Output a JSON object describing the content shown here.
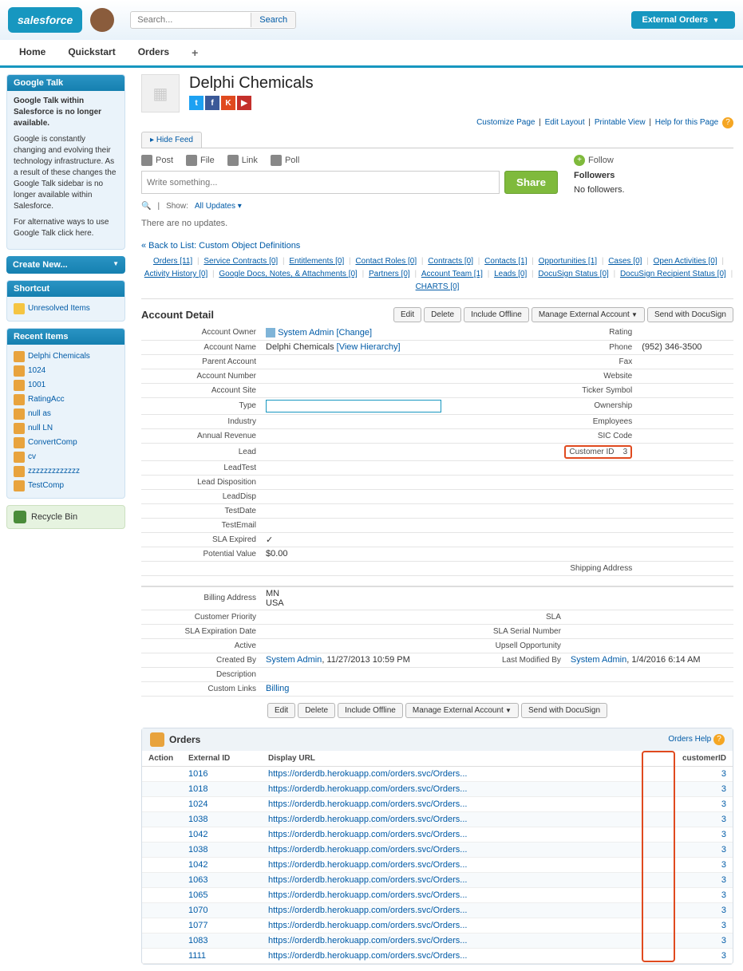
{
  "header": {
    "logo": "salesforce",
    "search_placeholder": "Search...",
    "search_btn": "Search",
    "ext_orders": "External Orders"
  },
  "tabs": [
    "Home",
    "Quickstart",
    "Orders"
  ],
  "sidebar": {
    "gtalk": {
      "title": "Google Talk",
      "line1": "Google Talk within Salesforce is no longer available.",
      "line2": "Google is constantly changing and evolving their technology infrastructure. As a result of these changes the Google Talk sidebar is no longer available within Salesforce.",
      "line3": "For alternative ways to use Google Talk click here."
    },
    "create_new": "Create New...",
    "shortcut": {
      "title": "Shortcut",
      "item": "Unresolved Items"
    },
    "recent": {
      "title": "Recent Items",
      "items": [
        "Delphi Chemicals",
        "1024",
        "1001",
        "RatingAcc",
        "null as",
        "null LN",
        "ConvertComp",
        "cv",
        "zzzzzzzzzzzzz",
        "TestComp"
      ]
    },
    "recycle": "Recycle Bin"
  },
  "page": {
    "title": "Delphi Chemicals",
    "top_links": [
      "Customize Page",
      "Edit Layout",
      "Printable View",
      "Help for this Page"
    ],
    "hide_feed": "Hide Feed",
    "feed_tabs": [
      "Post",
      "File",
      "Link",
      "Poll"
    ],
    "feed_placeholder": "Write something...",
    "share": "Share",
    "show": "Show:",
    "all_updates": "All Updates",
    "no_updates": "There are no updates.",
    "follow": "Follow",
    "followers": "Followers",
    "no_followers": "No followers.",
    "back": "« Back to List: Custom Object Definitions"
  },
  "related_nav": [
    {
      "label": "Orders",
      "count": "[11]"
    },
    {
      "label": "Service Contracts",
      "count": "[0]"
    },
    {
      "label": "Entitlements",
      "count": "[0]"
    },
    {
      "label": "Contact Roles",
      "count": "[0]"
    },
    {
      "label": "Contracts",
      "count": "[0]"
    },
    {
      "label": "Contacts",
      "count": "[1]"
    },
    {
      "label": "Opportunities",
      "count": "[1]"
    },
    {
      "label": "Cases",
      "count": "[0]"
    },
    {
      "label": "Open Activities",
      "count": "[0]"
    },
    {
      "label": "Activity History",
      "count": "[0]"
    },
    {
      "label": "Google Docs, Notes, & Attachments",
      "count": "[0]"
    },
    {
      "label": "Partners",
      "count": "[0]"
    },
    {
      "label": "Account Team",
      "count": "[1]"
    },
    {
      "label": "Leads",
      "count": "[0]"
    },
    {
      "label": "DocuSign Status",
      "count": "[0]"
    },
    {
      "label": "DocuSign Recipient Status",
      "count": "[0]"
    },
    {
      "label": "CHARTS",
      "count": "[0]"
    }
  ],
  "detail": {
    "title": "Account Detail",
    "buttons": [
      "Edit",
      "Delete",
      "Include Offline",
      "Manage External Account",
      "Send with DocuSign"
    ],
    "owner_lbl": "Account Owner",
    "owner_val": "System Admin",
    "owner_change": "[Change]",
    "rating_lbl": "Rating",
    "name_lbl": "Account Name",
    "name_val": "Delphi Chemicals",
    "view_h": "[View Hierarchy]",
    "phone_lbl": "Phone",
    "phone_val": "(952) 346-3500",
    "parent_lbl": "Parent Account",
    "fax_lbl": "Fax",
    "num_lbl": "Account Number",
    "web_lbl": "Website",
    "site_lbl": "Account Site",
    "ticker_lbl": "Ticker Symbol",
    "type_lbl": "Type",
    "own_lbl": "Ownership",
    "industry_lbl": "Industry",
    "emp_lbl": "Employees",
    "rev_lbl": "Annual Revenue",
    "sic_lbl": "SIC Code",
    "lead_lbl": "Lead",
    "custid_lbl": "Customer ID",
    "custid_val": "3",
    "leadtest_lbl": "LeadTest",
    "leaddisp_lbl": "Lead Disposition",
    "leaddisp2_lbl": "LeadDisp",
    "testdate_lbl": "TestDate",
    "testemail_lbl": "TestEmail",
    "sla_lbl": "SLA Expired",
    "sla_val": "✓",
    "pot_lbl": "Potential Value",
    "pot_val": "$0.00",
    "ship_lbl": "Shipping Address",
    "bill_lbl": "Billing Address",
    "bill_val1": "MN",
    "bill_val2": "USA",
    "prio_lbl": "Customer Priority",
    "sla2_lbl": "SLA",
    "slaexp_lbl": "SLA Expiration Date",
    "slaser_lbl": "SLA Serial Number",
    "active_lbl": "Active",
    "upsell_lbl": "Upsell Opportunity",
    "created_lbl": "Created By",
    "created_user": "System Admin",
    "created_date": ", 11/27/2013 10:59 PM",
    "modified_lbl": "Last Modified By",
    "modified_user": "System Admin",
    "modified_date": ", 1/4/2016 6:14 AM",
    "desc_lbl": "Description",
    "custom_lbl": "Custom Links",
    "custom_val": "Billing"
  },
  "orders": {
    "title": "Orders",
    "help": "Orders Help",
    "cols": {
      "action": "Action",
      "ext": "External ID",
      "url": "Display URL",
      "cust": "customerID"
    },
    "rows": [
      {
        "ext": "1016",
        "url": "https://orderdb.herokuapp.com/orders.svc/Orders...",
        "cust": "3"
      },
      {
        "ext": "1018",
        "url": "https://orderdb.herokuapp.com/orders.svc/Orders...",
        "cust": "3"
      },
      {
        "ext": "1024",
        "url": "https://orderdb.herokuapp.com/orders.svc/Orders...",
        "cust": "3"
      },
      {
        "ext": "1038",
        "url": "https://orderdb.herokuapp.com/orders.svc/Orders...",
        "cust": "3"
      },
      {
        "ext": "1042",
        "url": "https://orderdb.herokuapp.com/orders.svc/Orders...",
        "cust": "3"
      },
      {
        "ext": "1038",
        "url": "https://orderdb.herokuapp.com/orders.svc/Orders...",
        "cust": "3"
      },
      {
        "ext": "1042",
        "url": "https://orderdb.herokuapp.com/orders.svc/Orders...",
        "cust": "3"
      },
      {
        "ext": "1063",
        "url": "https://orderdb.herokuapp.com/orders.svc/Orders...",
        "cust": "3"
      },
      {
        "ext": "1065",
        "url": "https://orderdb.herokuapp.com/orders.svc/Orders...",
        "cust": "3"
      },
      {
        "ext": "1070",
        "url": "https://orderdb.herokuapp.com/orders.svc/Orders...",
        "cust": "3"
      },
      {
        "ext": "1077",
        "url": "https://orderdb.herokuapp.com/orders.svc/Orders...",
        "cust": "3"
      },
      {
        "ext": "1083",
        "url": "https://orderdb.herokuapp.com/orders.svc/Orders...",
        "cust": "3"
      },
      {
        "ext": "1111",
        "url": "https://orderdb.herokuapp.com/orders.svc/Orders...",
        "cust": "3"
      }
    ]
  }
}
